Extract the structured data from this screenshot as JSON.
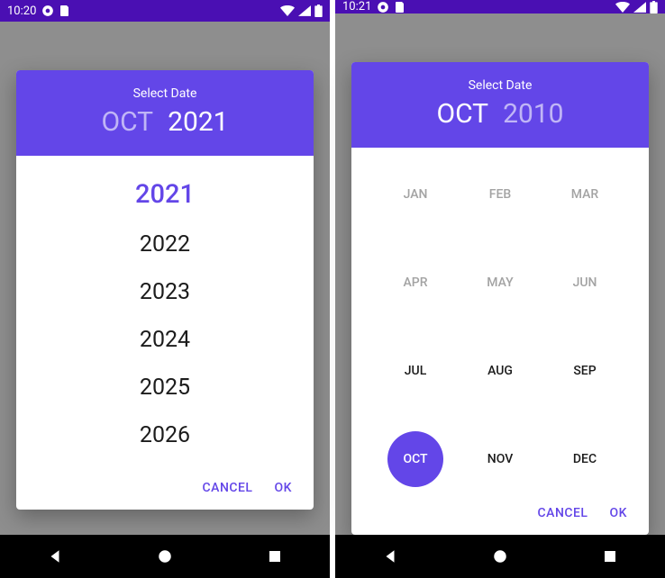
{
  "left": {
    "status": {
      "time": "10:20"
    },
    "header": {
      "title": "Select Date",
      "month": "OCT",
      "year": "2021"
    },
    "years": [
      "2021",
      "2022",
      "2023",
      "2024",
      "2025",
      "2026"
    ],
    "selected_year_index": 0,
    "footer": {
      "cancel": "CANCEL",
      "ok": "OK"
    }
  },
  "right": {
    "status": {
      "time": "10:21"
    },
    "header": {
      "title": "Select Date",
      "month": "OCT",
      "year": "2010"
    },
    "months": [
      "JAN",
      "FEB",
      "MAR",
      "APR",
      "MAY",
      "JUN",
      "JUL",
      "AUG",
      "SEP",
      "OCT",
      "NOV",
      "DEC"
    ],
    "dimmed_indices": [
      0,
      1,
      2,
      3,
      4,
      5
    ],
    "selected_month_index": 9,
    "footer": {
      "cancel": "CANCEL",
      "ok": "OK"
    }
  }
}
